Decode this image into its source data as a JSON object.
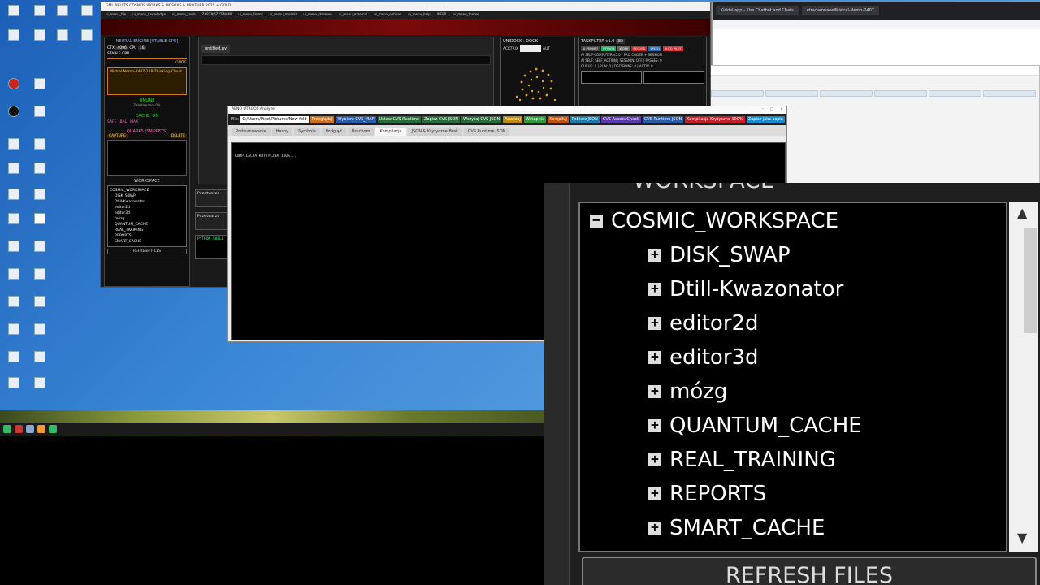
{
  "ide": {
    "title": "GML NEU.TS COSMOS WORKS & MOSUXS & BROTHER 2025 + GOLD",
    "menu": [
      "ui_menu_file",
      "ui_menu_knowledge",
      "ui_menu_tools",
      "ZARZĄDZ CENAMI",
      "ui_menu_forms",
      "ui_menu_models",
      "ui_menu_daemon",
      "ui_menu_external",
      "ui_menu_options",
      "ui_menu_help",
      "INFER",
      "ui_menu_theme"
    ],
    "left_panel": {
      "header": "NEURAL ENGINE [STABLE-CPU]",
      "ctx_label": "CTX",
      "ctx_value": "4096",
      "cpu_label": "CPU",
      "cpu_value": "16",
      "stable_label": "STABLE CPU",
      "ignite": "IGNITE",
      "model": "Mistral-Nemo-2407-12B-Thinking-Claud",
      "online": "ONLINE",
      "loaded": "Załadowano: 0%",
      "cache": "CACHE: ON",
      "mode_safe": "SAFE",
      "mode_bal": "BAL",
      "mode_max": "MAX",
      "quarks": "QUARKS (SNIPPETS)",
      "capture": "CAPTURE",
      "delete": "DELETE",
      "workspace": "WORKSPACE",
      "refresh": "REFRESH FILES"
    },
    "editor_tab": "untitled.py",
    "unidock": {
      "title": "UNIDOCK : DOCK",
      "acktrix": "ACKTRIX",
      "sel": "A",
      "auto": "AUT"
    },
    "taskputer": {
      "title": "TASKPUTER v1.0",
      "mode": "3D",
      "badges": [
        "AI PROMPT",
        "PYTHON",
        "WORK",
        "RECORD",
        "SPEED",
        "AUTO PILOT"
      ],
      "line1": "AI SELF-COMPUTER v5.0 : PRO CODER + SESSION",
      "line2": "AI SELF: SELF_ACTION | SESSION: OFF | PASSES: 0",
      "line3": "QUEUE: 0 | RUN: 0 | DECISIONS: 0 | ACTIV: 0"
    },
    "stubs": [
      "Przetwarza",
      "Przetwarza",
      "PYTHON SHELL"
    ]
  },
  "analyzer": {
    "title": "ABNO UTRGOS Analyzer",
    "plik_label": "Plik:",
    "path": "C:/Users/Pixel/Pictures/New fold",
    "buttons": [
      {
        "label": "Przeglądaj",
        "color": "#d0701a"
      },
      {
        "label": "Wybierz CVS_MAP",
        "color": "#2a5aa8"
      },
      {
        "label": "Ustaw CVS Runtime",
        "color": "#2a6a3a"
      },
      {
        "label": "Zapisz CVS JSON",
        "color": "#2a6a3a"
      },
      {
        "label": "Wczytaj CVS JSON",
        "color": "#2a6a3a"
      },
      {
        "label": "Analizuj",
        "color": "#c08a10"
      },
      {
        "label": "Wstępnie",
        "color": "#2a9a3a"
      },
      {
        "label": "Kompiluj",
        "color": "#c05010"
      },
      {
        "label": "Pobierz JSON",
        "color": "#1a7aa8"
      },
      {
        "label": "CVS Assets Check",
        "color": "#5a3aa8"
      },
      {
        "label": "CVS Runtime JSON",
        "color": "#2a5aa8"
      },
      {
        "label": "Kompilacja Krytyczna 100%",
        "color": "#c0202a"
      },
      {
        "label": "Zapisz jako kopie",
        "color": "#1a8ad0"
      }
    ],
    "tabs": [
      "Podsumowanie",
      "Hashy",
      "Symbole",
      "Podgląd",
      "Uruchom",
      "Kompilacja",
      "JSON & Krytyczne Brak",
      "CVS Runtime JSON"
    ],
    "active_tab": 5,
    "console": "KOMPILACJA KRYTYCZNA 100%..."
  },
  "browser": {
    "tabs": [
      "Kiddel.app - Kiss Chatbot and Chats",
      "etradamnaoe/Mistral-Nemo-2407"
    ]
  },
  "workspace_zoom": {
    "title": "WORKSPACE",
    "root": "COSMIC_WORKSPACE",
    "root_expander": "−",
    "items": [
      "DISK_SWAP",
      "Dtill-Kwazonator",
      "editor2d",
      "editor3d",
      "mózg",
      "QUANTUM_CACHE",
      "REAL_TRAINING",
      "REPORTS",
      "SMART_CACHE"
    ],
    "item_expander": "+",
    "scroll_up": "▲",
    "scroll_down": "▼",
    "refresh": "REFRESH FILES"
  }
}
